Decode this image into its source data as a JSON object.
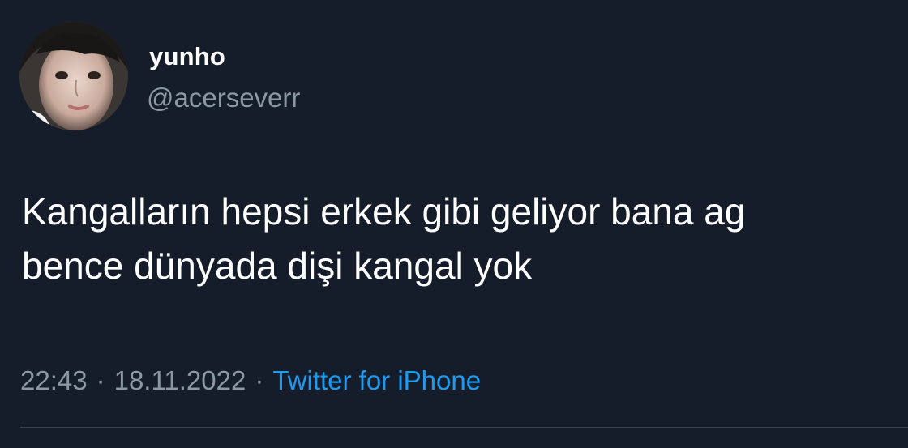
{
  "tweet": {
    "author": {
      "display_name": "yunho",
      "handle": "@acerseverr",
      "avatar_icon": "profile-photo"
    },
    "text_lines": [
      "Kangalların hepsi erkek gibi geliyor bana ag",
      "bence dünyada dişi kangal yok"
    ],
    "meta": {
      "time": "22:43",
      "separator": "·",
      "date": "18.11.2022",
      "source": "Twitter for iPhone"
    }
  },
  "colors": {
    "background": "#151d2b",
    "primary_text": "#ffffff",
    "secondary_text": "#8b98a5",
    "link": "#1d9bf0",
    "divider": "#38444d"
  }
}
